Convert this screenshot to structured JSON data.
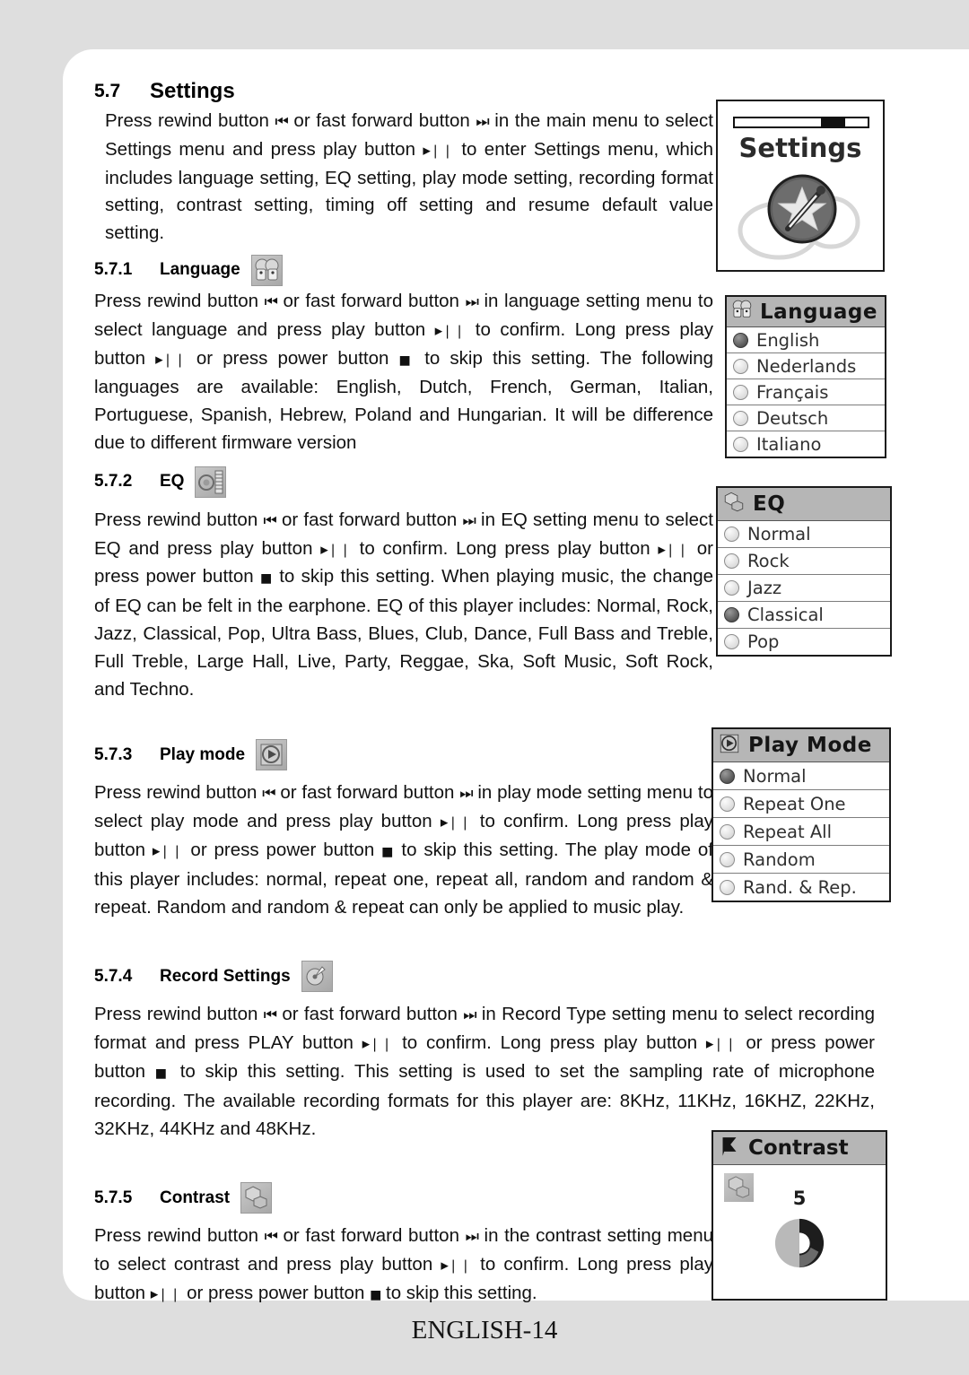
{
  "footer": {
    "page_label": "ENGLISH-14"
  },
  "glyphs": {
    "rewind": "⏮",
    "forward": "⏭",
    "play": "▸",
    "pause": "❘❘",
    "stop": "■"
  },
  "sections": {
    "settings": {
      "number": "5.7",
      "title": "Settings",
      "body_1": "Press rewind button ",
      "body_2": " or fast forward button ",
      "body_3": " in the main menu to select Settings menu and press play button ",
      "body_4": " to enter Settings menu, which includes language setting, EQ setting, play mode setting, recording format setting, contrast setting, timing off setting and resume default value setting."
    },
    "language": {
      "number": "5.7.1",
      "title": "Language",
      "icon": "two-faces-icon",
      "t1": "Press rewind button ",
      "t2": " or fast forward button ",
      "t3": " in language setting menu to select language and press play button ",
      "t4": " to confirm. Long press play button ",
      "t5": " or press power button ",
      "t6": " to skip this setting. The following languages are available: English, Dutch, French, German, Italian, Portuguese, Spanish, Hebrew, Poland and Hungarian. It will be difference due to different firmware version"
    },
    "eq": {
      "number": "5.7.2",
      "title": "EQ",
      "icon": "equalizer-icon",
      "t1": "Press rewind button ",
      "t2": " or fast forward button ",
      "t3": " in EQ setting menu to select EQ and press play button ",
      "t4": " to confirm. Long press play button ",
      "t5": " or press power button ",
      "t6": " to skip this setting. When playing music, the change of EQ can be felt in the earphone. EQ of this player includes: Normal, Rock, Jazz, Classical, Pop, Ultra Bass, Blues, Club, Dance, Full Bass and Treble, Full Treble, Large Hall, Live, Party, Reggae, Ska, Soft Music, Soft Rock, and Techno."
    },
    "play_mode": {
      "number": "5.7.3",
      "title": "Play mode",
      "icon": "play-mode-icon",
      "t1": "Press rewind button ",
      "t2": " or fast forward button ",
      "t3": " in play mode setting menu to select play mode and press play button ",
      "t4": " to confirm. Long press play button ",
      "t5": " or press power button ",
      "t6": " to skip this setting. The play mode of this player includes: normal, repeat one, repeat all, random and random & repeat. Random and random & repeat can only be applied to music play."
    },
    "record": {
      "number": "5.7.4",
      "title": "Record Settings",
      "icon": "microphone-icon",
      "t1": "Press rewind button ",
      "t2": " or fast forward button ",
      "t3": " in Record Type setting menu to select recording format and press PLAY button ",
      "t4": " to confirm. Long press play button ",
      "t5": " or press power button ",
      "t6": " to skip this setting. This setting is used to set the sampling rate of microphone recording. The available recording formats for this player are: 8KHz, 11KHz, 16KHZ, 22KHz, 32KHz, 44KHz and 48KHz."
    },
    "contrast": {
      "number": "5.7.5",
      "title": "Contrast",
      "icon": "cubes-icon",
      "t1": "Press rewind button ",
      "t2": " or fast forward button ",
      "t3": " in the contrast setting menu to select contrast and press play button ",
      "t4": " to confirm. Long press play button ",
      "t5": " or press power button ",
      "t6": " to skip this setting."
    }
  },
  "screens": {
    "settings_splash": {
      "title": "Settings",
      "icon": "star-screwdriver-icon",
      "scrollbar_fill_percent": 18
    },
    "language_menu": {
      "header": "Language",
      "header_icon": "two-faces-icon",
      "items": [
        {
          "label": "English",
          "selected": true
        },
        {
          "label": "Nederlands",
          "selected": false
        },
        {
          "label": "Français",
          "selected": false
        },
        {
          "label": "Deutsch",
          "selected": false
        },
        {
          "label": "Italiano",
          "selected": false
        }
      ]
    },
    "eq_menu": {
      "header": "EQ",
      "header_icon": "cubes-icon",
      "items": [
        {
          "label": "Normal",
          "selected": false
        },
        {
          "label": "Rock",
          "selected": false
        },
        {
          "label": "Jazz",
          "selected": false
        },
        {
          "label": "Classical",
          "selected": true
        },
        {
          "label": "Pop",
          "selected": false
        }
      ]
    },
    "play_mode_menu": {
      "header": "Play Mode",
      "header_icon": "play-mode-icon",
      "items": [
        {
          "label": "Normal",
          "selected": true
        },
        {
          "label": "Repeat One",
          "selected": false
        },
        {
          "label": "Repeat All",
          "selected": false
        },
        {
          "label": "Random",
          "selected": false
        },
        {
          "label": "Rand. & Rep.",
          "selected": false
        }
      ]
    },
    "contrast_screen": {
      "header": "Contrast",
      "header_icon": "flag-icon",
      "body_icon": "cubes-icon",
      "value": "5"
    }
  },
  "colors": {
    "page_background": "#dedede",
    "page_surface": "#ffffff",
    "menu_header": "#b6b6b6",
    "ink": "#111111"
  }
}
